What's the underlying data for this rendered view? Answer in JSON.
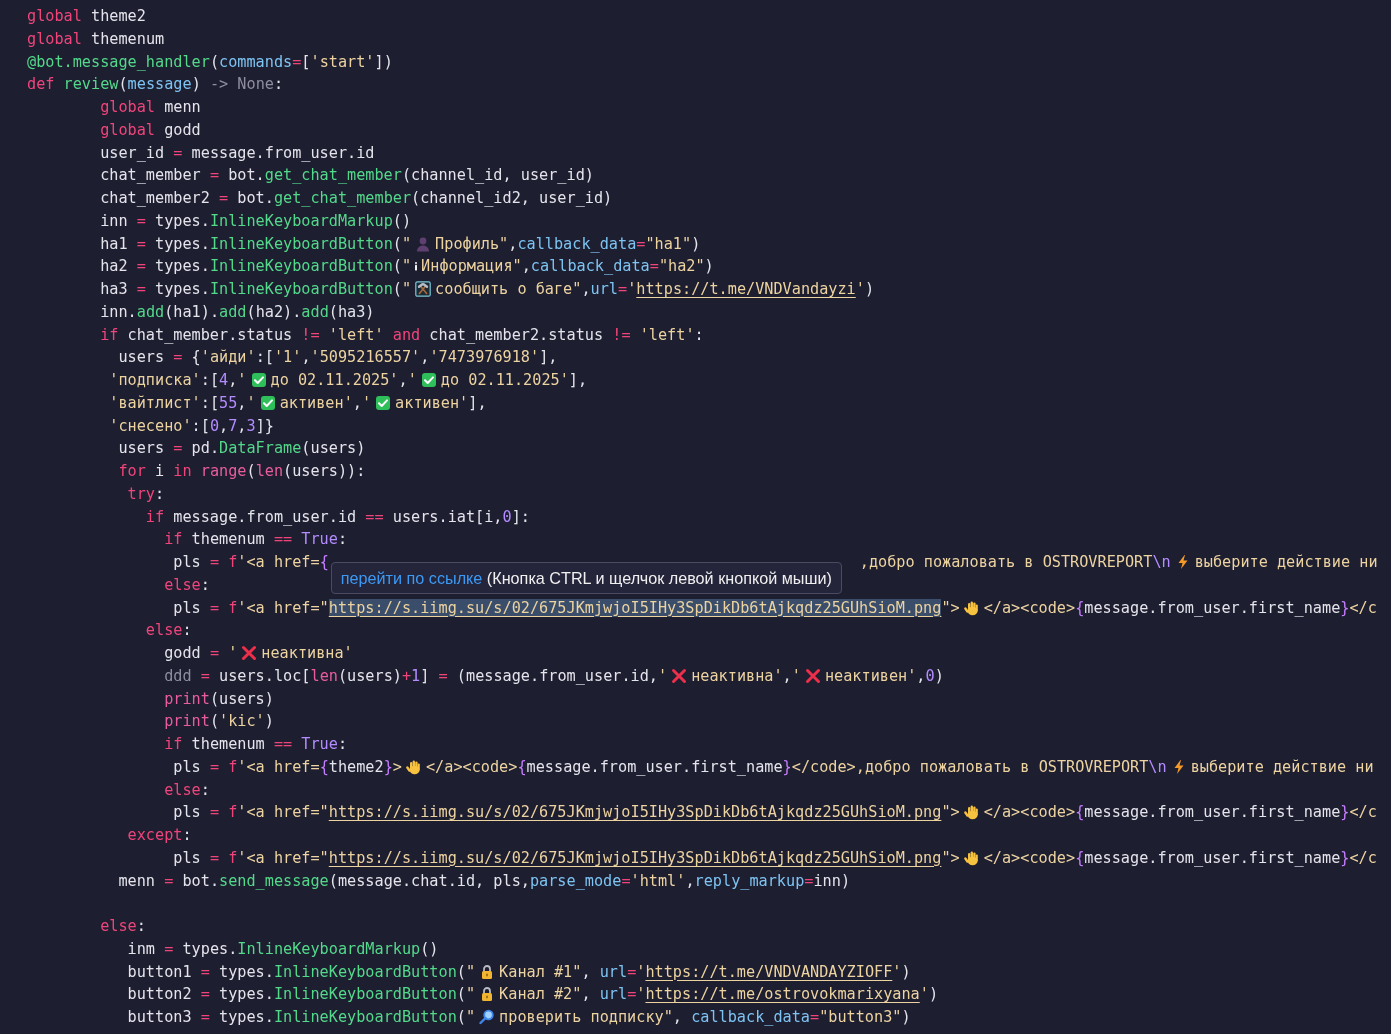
{
  "editor": {
    "lines": [
      {
        "kind": "code",
        "tokens": [
          {
            "kind": "keyword",
            "text": "global"
          },
          {
            "kind": "plain",
            "text": " theme2"
          }
        ]
      },
      {
        "kind": "code",
        "tokens": [
          {
            "kind": "keyword",
            "text": "global"
          },
          {
            "kind": "plain",
            "text": " themenum"
          }
        ]
      },
      {
        "kind": "code",
        "tokens": [
          {
            "kind": "function",
            "text": "@bot.message_handler"
          },
          {
            "kind": "plain",
            "text": "("
          },
          {
            "kind": "param",
            "text": "commands"
          },
          {
            "kind": "operator",
            "text": "="
          },
          {
            "kind": "plain",
            "text": "["
          },
          {
            "kind": "string",
            "text": "'start'"
          },
          {
            "kind": "plain",
            "text": "])"
          }
        ]
      },
      {
        "kind": "code",
        "tokens": [
          {
            "kind": "keyword",
            "text": "def "
          },
          {
            "kind": "function",
            "text": "review"
          },
          {
            "kind": "plain",
            "text": "("
          },
          {
            "kind": "param",
            "text": "message"
          },
          {
            "kind": "plain",
            "text": ")"
          },
          {
            "kind": "muted",
            "text": " -> None"
          },
          {
            "kind": "plain",
            "text": ":"
          }
        ]
      },
      {
        "kind": "code",
        "tokens": [
          {
            "kind": "keyword",
            "text": "        global"
          },
          {
            "kind": "plain",
            "text": " menn"
          }
        ]
      },
      {
        "kind": "code",
        "tokens": [
          {
            "kind": "keyword",
            "text": "        global"
          },
          {
            "kind": "plain",
            "text": " godd"
          }
        ]
      },
      {
        "kind": "code",
        "tokens": [
          {
            "kind": "plain",
            "text": "        user_id "
          },
          {
            "kind": "operator",
            "text": "="
          },
          {
            "kind": "plain",
            "text": " message.from_user.id"
          }
        ]
      },
      {
        "kind": "code",
        "tokens": [
          {
            "kind": "plain",
            "text": "        chat_member "
          },
          {
            "kind": "operator",
            "text": "="
          },
          {
            "kind": "plain",
            "text": " bot."
          },
          {
            "kind": "function",
            "text": "get_chat_member"
          },
          {
            "kind": "plain",
            "text": "(channel_id, user_id)"
          }
        ]
      },
      {
        "kind": "code",
        "tokens": [
          {
            "kind": "plain",
            "text": "        chat_member2 "
          },
          {
            "kind": "operator",
            "text": "="
          },
          {
            "kind": "plain",
            "text": " bot."
          },
          {
            "kind": "function",
            "text": "get_chat_member"
          },
          {
            "kind": "plain",
            "text": "(channel_id2, user_id)"
          }
        ]
      },
      {
        "kind": "code",
        "tokens": [
          {
            "kind": "plain",
            "text": "        inn "
          },
          {
            "kind": "operator",
            "text": "="
          },
          {
            "kind": "plain",
            "text": " types."
          },
          {
            "kind": "function",
            "text": "InlineKeyboardMarkup"
          },
          {
            "kind": "plain",
            "text": "()"
          }
        ]
      },
      {
        "kind": "code",
        "tokens": [
          {
            "kind": "plain",
            "text": "        ha1 "
          },
          {
            "kind": "operator",
            "text": "="
          },
          {
            "kind": "plain",
            "text": " types."
          },
          {
            "kind": "function",
            "text": "InlineKeyboardButton"
          },
          {
            "kind": "plain",
            "text": "("
          },
          {
            "kind": "string",
            "text": "\""
          },
          {
            "kind": "person-emoji"
          },
          {
            "kind": "string",
            "text": "Профиль\""
          },
          {
            "kind": "plain",
            "text": ","
          },
          {
            "kind": "param",
            "text": "callback_data"
          },
          {
            "kind": "operator",
            "text": "="
          },
          {
            "kind": "string",
            "text": "\"ha1\""
          },
          {
            "kind": "plain",
            "text": ")"
          }
        ]
      },
      {
        "kind": "code",
        "tokens": [
          {
            "kind": "plain",
            "text": "        ha2 "
          },
          {
            "kind": "operator",
            "text": "="
          },
          {
            "kind": "plain",
            "text": " types."
          },
          {
            "kind": "function",
            "text": "InlineKeyboardButton"
          },
          {
            "kind": "plain",
            "text": "("
          },
          {
            "kind": "string",
            "text": "\""
          },
          {
            "kind": "info-emoji"
          },
          {
            "kind": "string",
            "text": "Информация\""
          },
          {
            "kind": "plain",
            "text": ","
          },
          {
            "kind": "param",
            "text": "callback_data"
          },
          {
            "kind": "operator",
            "text": "="
          },
          {
            "kind": "string",
            "text": "\"ha2\""
          },
          {
            "kind": "plain",
            "text": ")"
          }
        ]
      },
      {
        "kind": "code",
        "tokens": [
          {
            "kind": "plain",
            "text": "        ha3 "
          },
          {
            "kind": "operator",
            "text": "="
          },
          {
            "kind": "plain",
            "text": " types."
          },
          {
            "kind": "function",
            "text": "InlineKeyboardButton"
          },
          {
            "kind": "plain",
            "text": "("
          },
          {
            "kind": "string",
            "text": "\""
          },
          {
            "kind": "hammer-emoji"
          },
          {
            "kind": "string",
            "text": "сообщить о баге\""
          },
          {
            "kind": "plain",
            "text": ","
          },
          {
            "kind": "param",
            "text": "url"
          },
          {
            "kind": "operator",
            "text": "="
          },
          {
            "kind": "string",
            "text": "'"
          },
          {
            "kind": "link",
            "text": "https://t.me/VNDVandayzi",
            "selected": false
          },
          {
            "kind": "string",
            "text": "'"
          },
          {
            "kind": "plain",
            "text": ")"
          }
        ]
      },
      {
        "kind": "code",
        "tokens": [
          {
            "kind": "plain",
            "text": "        inn."
          },
          {
            "kind": "function",
            "text": "add"
          },
          {
            "kind": "plain",
            "text": "(ha1)."
          },
          {
            "kind": "function",
            "text": "add"
          },
          {
            "kind": "plain",
            "text": "(ha2)."
          },
          {
            "kind": "function",
            "text": "add"
          },
          {
            "kind": "plain",
            "text": "(ha3)"
          }
        ]
      },
      {
        "kind": "code",
        "tokens": [
          {
            "kind": "keyword",
            "text": "        if"
          },
          {
            "kind": "plain",
            "text": " chat_member.status "
          },
          {
            "kind": "operator",
            "text": "!= "
          },
          {
            "kind": "string",
            "text": "'left' "
          },
          {
            "kind": "keyword",
            "text": "and"
          },
          {
            "kind": "plain",
            "text": " chat_member2.status "
          },
          {
            "kind": "operator",
            "text": "!= "
          },
          {
            "kind": "string",
            "text": "'left'"
          },
          {
            "kind": "plain",
            "text": ":"
          }
        ]
      },
      {
        "kind": "code",
        "tokens": [
          {
            "kind": "plain",
            "text": "          users "
          },
          {
            "kind": "operator",
            "text": "="
          },
          {
            "kind": "plain",
            "text": " {"
          },
          {
            "kind": "string",
            "text": "'айди'"
          },
          {
            "kind": "plain",
            "text": ":["
          },
          {
            "kind": "string",
            "text": "'1'"
          },
          {
            "kind": "plain",
            "text": ","
          },
          {
            "kind": "string",
            "text": "'5095216557'"
          },
          {
            "kind": "plain",
            "text": ","
          },
          {
            "kind": "string",
            "text": "'7473976918'"
          },
          {
            "kind": "plain",
            "text": "],"
          }
        ]
      },
      {
        "kind": "code",
        "tokens": [
          {
            "kind": "string",
            "text": "         'подписка'"
          },
          {
            "kind": "plain",
            "text": ":["
          },
          {
            "kind": "number",
            "text": "4"
          },
          {
            "kind": "plain",
            "text": ","
          },
          {
            "kind": "string",
            "text": "'"
          },
          {
            "kind": "check-emoji"
          },
          {
            "kind": "string",
            "text": "до 02.11.2025'"
          },
          {
            "kind": "plain",
            "text": ","
          },
          {
            "kind": "string",
            "text": "'"
          },
          {
            "kind": "check-emoji"
          },
          {
            "kind": "string",
            "text": "до 02.11.2025'"
          },
          {
            "kind": "plain",
            "text": "],"
          }
        ]
      },
      {
        "kind": "code",
        "tokens": [
          {
            "kind": "string",
            "text": "         'вайтлист'"
          },
          {
            "kind": "plain",
            "text": ":["
          },
          {
            "kind": "number",
            "text": "55"
          },
          {
            "kind": "plain",
            "text": ","
          },
          {
            "kind": "string",
            "text": "'"
          },
          {
            "kind": "check-emoji"
          },
          {
            "kind": "string",
            "text": "активен'"
          },
          {
            "kind": "plain",
            "text": ","
          },
          {
            "kind": "string",
            "text": "'"
          },
          {
            "kind": "check-emoji"
          },
          {
            "kind": "string",
            "text": "активен'"
          },
          {
            "kind": "plain",
            "text": "],"
          }
        ]
      },
      {
        "kind": "code",
        "tokens": [
          {
            "kind": "string",
            "text": "         'снесено'"
          },
          {
            "kind": "plain",
            "text": ":["
          },
          {
            "kind": "number",
            "text": "0"
          },
          {
            "kind": "plain",
            "text": ","
          },
          {
            "kind": "number",
            "text": "7"
          },
          {
            "kind": "plain",
            "text": ","
          },
          {
            "kind": "number",
            "text": "3"
          },
          {
            "kind": "plain",
            "text": "]}"
          }
        ]
      },
      {
        "kind": "code",
        "tokens": [
          {
            "kind": "plain",
            "text": "          users "
          },
          {
            "kind": "operator",
            "text": "="
          },
          {
            "kind": "plain",
            "text": " pd."
          },
          {
            "kind": "function",
            "text": "DataFrame"
          },
          {
            "kind": "plain",
            "text": "(users)"
          }
        ]
      },
      {
        "kind": "code",
        "tokens": [
          {
            "kind": "keyword",
            "text": "          for"
          },
          {
            "kind": "plain",
            "text": " i "
          },
          {
            "kind": "keyword",
            "text": "in "
          },
          {
            "kind": "builtin",
            "text": "range"
          },
          {
            "kind": "plain",
            "text": "("
          },
          {
            "kind": "builtin",
            "text": "len"
          },
          {
            "kind": "plain",
            "text": "(users)):"
          }
        ]
      },
      {
        "kind": "code",
        "tokens": [
          {
            "kind": "keyword",
            "text": "           try"
          },
          {
            "kind": "plain",
            "text": ":"
          }
        ]
      },
      {
        "kind": "code",
        "tokens": [
          {
            "kind": "keyword",
            "text": "             if"
          },
          {
            "kind": "plain",
            "text": " message.from_user.id "
          },
          {
            "kind": "operator",
            "text": "=="
          },
          {
            "kind": "plain",
            "text": " users.iat[i,"
          },
          {
            "kind": "number",
            "text": "0"
          },
          {
            "kind": "plain",
            "text": "]:"
          }
        ]
      },
      {
        "kind": "code",
        "tokens": [
          {
            "kind": "keyword",
            "text": "               if"
          },
          {
            "kind": "plain",
            "text": " themenum "
          },
          {
            "kind": "operator",
            "text": "== "
          },
          {
            "kind": "number",
            "text": "True"
          },
          {
            "kind": "plain",
            "text": ":"
          }
        ]
      },
      {
        "kind": "code",
        "tokens": [
          {
            "kind": "plain",
            "text": "                pls "
          },
          {
            "kind": "operator",
            "text": "= "
          },
          {
            "kind": "keyword",
            "text": "f"
          },
          {
            "kind": "string",
            "text": "'<a href="
          },
          {
            "kind": "brace",
            "text": "{"
          },
          {
            "kind": "covered"
          },
          {
            "kind": "string",
            "text": ",добро пожаловать в OSTROVREPORT"
          },
          {
            "kind": "escape",
            "text": "\\n"
          },
          {
            "kind": "bolt-emoji"
          },
          {
            "kind": "string",
            "text": "выберите действие ни"
          }
        ]
      },
      {
        "kind": "code",
        "tokens": [
          {
            "kind": "keyword",
            "text": "               else"
          },
          {
            "kind": "plain",
            "text": ":"
          }
        ]
      },
      {
        "kind": "code",
        "tokens": [
          {
            "kind": "plain",
            "text": "                pls "
          },
          {
            "kind": "operator",
            "text": "= "
          },
          {
            "kind": "keyword",
            "text": "f"
          },
          {
            "kind": "string",
            "text": "'<a href=\""
          },
          {
            "kind": "link",
            "text": "https://s.iimg.su/s/02/675JKmjwjoI5IHy3SpDikDb6tAjkqdz25GUhSioM.png",
            "selected": true
          },
          {
            "kind": "string",
            "text": "\">"
          },
          {
            "kind": "hand-emoji"
          },
          {
            "kind": "string",
            "text": "</a><code>"
          },
          {
            "kind": "brace",
            "text": "{"
          },
          {
            "kind": "plain",
            "text": "message.from_user.first_name"
          },
          {
            "kind": "brace",
            "text": "}"
          },
          {
            "kind": "string",
            "text": "</c"
          }
        ]
      },
      {
        "kind": "code",
        "tokens": [
          {
            "kind": "keyword",
            "text": "             else"
          },
          {
            "kind": "plain",
            "text": ":"
          }
        ]
      },
      {
        "kind": "code",
        "tokens": [
          {
            "kind": "plain",
            "text": "               godd "
          },
          {
            "kind": "operator",
            "text": "= "
          },
          {
            "kind": "string",
            "text": "'"
          },
          {
            "kind": "cross-emoji"
          },
          {
            "kind": "string",
            "text": "неактивна'"
          }
        ]
      },
      {
        "kind": "code",
        "tokens": [
          {
            "kind": "muted",
            "text": "               ddd "
          },
          {
            "kind": "operator",
            "text": "="
          },
          {
            "kind": "plain",
            "text": " users.loc["
          },
          {
            "kind": "builtin",
            "text": "len"
          },
          {
            "kind": "plain",
            "text": "(users)"
          },
          {
            "kind": "operator",
            "text": "+"
          },
          {
            "kind": "number",
            "text": "1"
          },
          {
            "kind": "plain",
            "text": "] "
          },
          {
            "kind": "operator",
            "text": "="
          },
          {
            "kind": "plain",
            "text": " (message.from_user.id,"
          },
          {
            "kind": "string",
            "text": "'"
          },
          {
            "kind": "cross-emoji"
          },
          {
            "kind": "string",
            "text": "неактивна'"
          },
          {
            "kind": "plain",
            "text": ","
          },
          {
            "kind": "string",
            "text": "'"
          },
          {
            "kind": "cross-emoji"
          },
          {
            "kind": "string",
            "text": "неактивен'"
          },
          {
            "kind": "plain",
            "text": ","
          },
          {
            "kind": "number",
            "text": "0"
          },
          {
            "kind": "plain",
            "text": ")"
          }
        ]
      },
      {
        "kind": "code",
        "tokens": [
          {
            "kind": "builtin",
            "text": "               print"
          },
          {
            "kind": "plain",
            "text": "(users)"
          }
        ]
      },
      {
        "kind": "code",
        "tokens": [
          {
            "kind": "builtin",
            "text": "               print"
          },
          {
            "kind": "plain",
            "text": "("
          },
          {
            "kind": "string",
            "text": "'kic'"
          },
          {
            "kind": "plain",
            "text": ")"
          }
        ]
      },
      {
        "kind": "code",
        "tokens": [
          {
            "kind": "keyword",
            "text": "               if"
          },
          {
            "kind": "plain",
            "text": " themenum "
          },
          {
            "kind": "operator",
            "text": "== "
          },
          {
            "kind": "number",
            "text": "True"
          },
          {
            "kind": "plain",
            "text": ":"
          }
        ]
      },
      {
        "kind": "code",
        "tokens": [
          {
            "kind": "plain",
            "text": "                pls "
          },
          {
            "kind": "operator",
            "text": "= "
          },
          {
            "kind": "keyword",
            "text": "f"
          },
          {
            "kind": "string",
            "text": "'<a href="
          },
          {
            "kind": "brace",
            "text": "{"
          },
          {
            "kind": "plain",
            "text": "theme2"
          },
          {
            "kind": "brace",
            "text": "}"
          },
          {
            "kind": "string",
            "text": ">"
          },
          {
            "kind": "hand-emoji"
          },
          {
            "kind": "string",
            "text": "</a><code>"
          },
          {
            "kind": "brace",
            "text": "{"
          },
          {
            "kind": "plain",
            "text": "message.from_user.first_name"
          },
          {
            "kind": "brace",
            "text": "}"
          },
          {
            "kind": "string",
            "text": "</code>,добро пожаловать в OSTROVREPORT"
          },
          {
            "kind": "escape",
            "text": "\\n"
          },
          {
            "kind": "bolt-emoji"
          },
          {
            "kind": "string",
            "text": "выберите действие ни"
          }
        ]
      },
      {
        "kind": "code",
        "tokens": [
          {
            "kind": "keyword",
            "text": "               else"
          },
          {
            "kind": "plain",
            "text": ":"
          }
        ]
      },
      {
        "kind": "code",
        "tokens": [
          {
            "kind": "plain",
            "text": "                pls "
          },
          {
            "kind": "operator",
            "text": "= "
          },
          {
            "kind": "keyword",
            "text": "f"
          },
          {
            "kind": "string",
            "text": "'<a href=\""
          },
          {
            "kind": "link",
            "text": "https://s.iimg.su/s/02/675JKmjwjoI5IHy3SpDikDb6tAjkqdz25GUhSioM.png",
            "selected": false
          },
          {
            "kind": "string",
            "text": "\">"
          },
          {
            "kind": "hand-emoji"
          },
          {
            "kind": "string",
            "text": "</a><code>"
          },
          {
            "kind": "brace",
            "text": "{"
          },
          {
            "kind": "plain",
            "text": "message.from_user.first_name"
          },
          {
            "kind": "brace",
            "text": "}"
          },
          {
            "kind": "string",
            "text": "</c"
          }
        ]
      },
      {
        "kind": "code",
        "tokens": [
          {
            "kind": "keyword",
            "text": "           except"
          },
          {
            "kind": "plain",
            "text": ":"
          }
        ]
      },
      {
        "kind": "code",
        "tokens": [
          {
            "kind": "plain",
            "text": "                pls "
          },
          {
            "kind": "operator",
            "text": "= "
          },
          {
            "kind": "keyword",
            "text": "f"
          },
          {
            "kind": "string",
            "text": "'<a href=\""
          },
          {
            "kind": "link",
            "text": "https://s.iimg.su/s/02/675JKmjwjoI5IHy3SpDikDb6tAjkqdz25GUhSioM.png",
            "selected": false
          },
          {
            "kind": "string",
            "text": "\">"
          },
          {
            "kind": "hand-emoji"
          },
          {
            "kind": "string",
            "text": "</a><code>"
          },
          {
            "kind": "brace",
            "text": "{"
          },
          {
            "kind": "plain",
            "text": "message.from_user.first_name"
          },
          {
            "kind": "brace",
            "text": "}"
          },
          {
            "kind": "string",
            "text": "</c"
          }
        ]
      },
      {
        "kind": "code",
        "tokens": [
          {
            "kind": "plain",
            "text": "          menn "
          },
          {
            "kind": "operator",
            "text": "="
          },
          {
            "kind": "plain",
            "text": " bot."
          },
          {
            "kind": "function",
            "text": "send_message"
          },
          {
            "kind": "plain",
            "text": "(message.chat.id, pls,"
          },
          {
            "kind": "param",
            "text": "parse_mode"
          },
          {
            "kind": "operator",
            "text": "="
          },
          {
            "kind": "string",
            "text": "'html'"
          },
          {
            "kind": "plain",
            "text": ","
          },
          {
            "kind": "param",
            "text": "reply_markup"
          },
          {
            "kind": "operator",
            "text": "="
          },
          {
            "kind": "plain",
            "text": "inn)"
          }
        ]
      },
      {
        "kind": "blank"
      },
      {
        "kind": "code",
        "tokens": [
          {
            "kind": "keyword",
            "text": "        else"
          },
          {
            "kind": "plain",
            "text": ":"
          }
        ]
      },
      {
        "kind": "code",
        "tokens": [
          {
            "kind": "plain",
            "text": "           inm "
          },
          {
            "kind": "operator",
            "text": "="
          },
          {
            "kind": "plain",
            "text": " types."
          },
          {
            "kind": "function",
            "text": "InlineKeyboardMarkup"
          },
          {
            "kind": "plain",
            "text": "()"
          }
        ]
      },
      {
        "kind": "code",
        "tokens": [
          {
            "kind": "plain",
            "text": "           button1 "
          },
          {
            "kind": "operator",
            "text": "="
          },
          {
            "kind": "plain",
            "text": " types."
          },
          {
            "kind": "function",
            "text": "InlineKeyboardButton"
          },
          {
            "kind": "plain",
            "text": "("
          },
          {
            "kind": "string",
            "text": "\""
          },
          {
            "kind": "lock-emoji"
          },
          {
            "kind": "string",
            "text": "Канал #1\""
          },
          {
            "kind": "plain",
            "text": ", "
          },
          {
            "kind": "param",
            "text": "url"
          },
          {
            "kind": "operator",
            "text": "="
          },
          {
            "kind": "string",
            "text": "'"
          },
          {
            "kind": "link",
            "text": "https://t.me/VNDVANDAYZIOFF",
            "selected": false
          },
          {
            "kind": "string",
            "text": "'"
          },
          {
            "kind": "plain",
            "text": ")"
          }
        ]
      },
      {
        "kind": "code",
        "tokens": [
          {
            "kind": "plain",
            "text": "           button2 "
          },
          {
            "kind": "operator",
            "text": "="
          },
          {
            "kind": "plain",
            "text": " types."
          },
          {
            "kind": "function",
            "text": "InlineKeyboardButton"
          },
          {
            "kind": "plain",
            "text": "("
          },
          {
            "kind": "string",
            "text": "\""
          },
          {
            "kind": "lock-emoji"
          },
          {
            "kind": "string",
            "text": "Канал #2\""
          },
          {
            "kind": "plain",
            "text": ", "
          },
          {
            "kind": "param",
            "text": "url"
          },
          {
            "kind": "operator",
            "text": "="
          },
          {
            "kind": "string",
            "text": "'"
          },
          {
            "kind": "link",
            "text": "https://t.me/ostrovokmarixyana",
            "selected": false
          },
          {
            "kind": "string",
            "text": "'"
          },
          {
            "kind": "plain",
            "text": ")"
          }
        ]
      },
      {
        "kind": "code",
        "tokens": [
          {
            "kind": "plain",
            "text": "           button3 "
          },
          {
            "kind": "operator",
            "text": "="
          },
          {
            "kind": "plain",
            "text": " types."
          },
          {
            "kind": "function",
            "text": "InlineKeyboardButton"
          },
          {
            "kind": "plain",
            "text": "("
          },
          {
            "kind": "string",
            "text": "\""
          },
          {
            "kind": "magnifier-emoji"
          },
          {
            "kind": "string",
            "text": "проверить подписку\""
          },
          {
            "kind": "plain",
            "text": ", "
          },
          {
            "kind": "param",
            "text": "callback_data"
          },
          {
            "kind": "operator",
            "text": "="
          },
          {
            "kind": "string",
            "text": "\"button3\""
          },
          {
            "kind": "plain",
            "text": ")"
          }
        ]
      }
    ],
    "link_tooltip": {
      "action": "перейти по ссылке",
      "hint": "(Кнопка CTRL и щелчок левой кнопкой мыши)"
    }
  }
}
